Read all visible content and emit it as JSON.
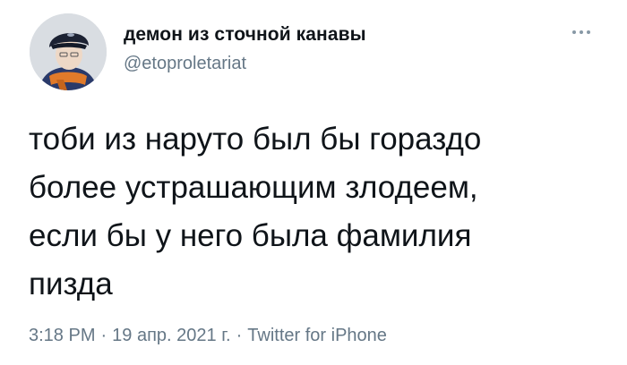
{
  "tweet": {
    "author": {
      "display_name": "демон из сточной канавы",
      "handle": "@etoproletariat"
    },
    "more_icon": "more-horizontal-icon",
    "text_lines": [
      "тоби из наруто был бы гораздо",
      "более устрашающим злодеем,",
      "если бы у него была фамилия",
      "пизда"
    ],
    "meta": {
      "time": "3:18 PM",
      "separator": "·",
      "date": "19 апр. 2021 г.",
      "source": "Twitter for iPhone"
    },
    "colors": {
      "text": "#0f1419",
      "secondary": "#657786"
    }
  }
}
